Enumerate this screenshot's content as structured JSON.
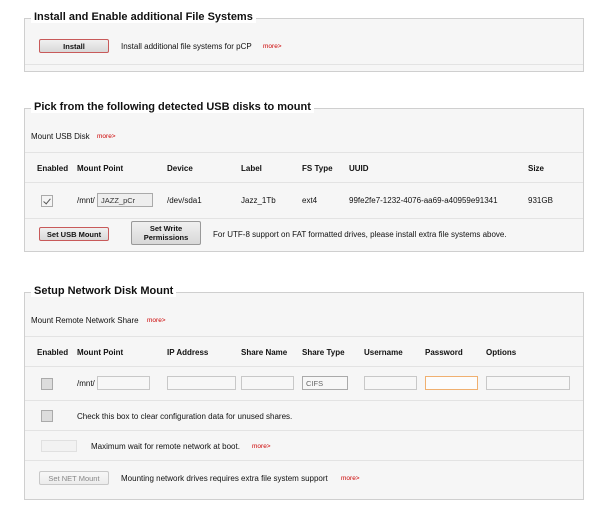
{
  "install_section": {
    "title": "Install and Enable additional File Systems",
    "button": "Install",
    "description": "Install additional file systems for pCP",
    "more": "more>"
  },
  "usb_section": {
    "title": "Pick from the following detected USB disks to mount",
    "subtitle": "Mount USB Disk",
    "more": "more>",
    "headers": [
      "Enabled",
      "Mount Point",
      "Device",
      "Label",
      "FS Type",
      "UUID",
      "Size"
    ],
    "disk": {
      "enabled": true,
      "mount_prefix": "/mnt/",
      "mount_value": "JAZZ_pCr",
      "device": "/dev/sda1",
      "label": "Jazz_1Tb",
      "fs_type": "ext4",
      "uuid": "99fe2fe7-1232-4076-aa69-a40959e91341",
      "size": "931GB"
    },
    "set_mount_button": "Set USB Mount",
    "set_write_button_line1": "Set Write",
    "set_write_button_line2": "Permissions",
    "utf8_note": "For UTF-8 support on FAT formatted drives, please install extra file systems above."
  },
  "network_section": {
    "title": "Setup Network Disk Mount",
    "subtitle": "Mount Remote Network Share",
    "more": "more>",
    "headers": [
      "Enabled",
      "Mount Point",
      "IP Address",
      "Share Name",
      "Share Type",
      "Username",
      "Password",
      "Options"
    ],
    "mount_prefix": "/mnt/",
    "share_type_value": "CIFS",
    "clear_note": "Check this box to clear configuration data for unused shares.",
    "wait_note": "Maximum wait for remote network at boot.",
    "wait_more": "more>",
    "set_net_button": "Set NET Mount",
    "net_note": "Mounting network drives requires extra file system support",
    "net_more": "more>"
  }
}
